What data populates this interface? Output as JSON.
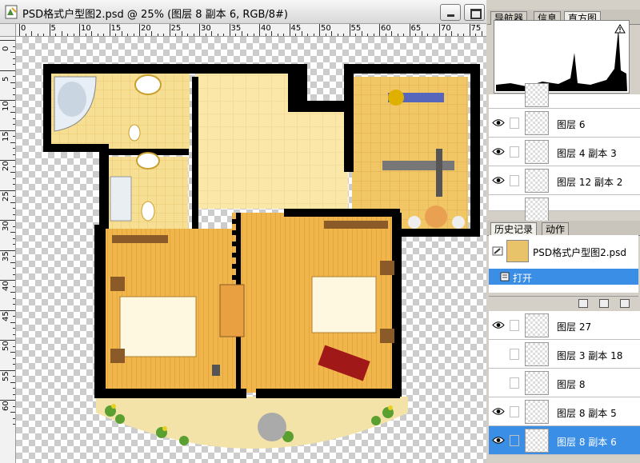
{
  "document": {
    "title": "PSD格式户型图2.psd @ 25% (图层 8 副本 6, RGB/8#)"
  },
  "rulers": {
    "horizontal": [
      "0",
      "5",
      "10",
      "15",
      "20",
      "25",
      "30",
      "35",
      "40",
      "45",
      "50",
      "55",
      "60",
      "65",
      "70",
      "75"
    ],
    "vertical": [
      "0",
      "5",
      "10",
      "15",
      "20",
      "25",
      "30",
      "35",
      "40",
      "45",
      "50",
      "55",
      "60"
    ]
  },
  "navigator_panel": {
    "tabs": [
      "导航器",
      "信息",
      "直方图"
    ],
    "active_tab": "直方图"
  },
  "layers_top": [
    {
      "name": "图层 6",
      "visible": true
    },
    {
      "name": "图层 4 副本 3",
      "visible": true
    },
    {
      "name": "图层 12 副本 2",
      "visible": true
    }
  ],
  "history_panel": {
    "tabs": [
      "历史记录",
      "动作"
    ],
    "active_tab": "历史记录",
    "snapshot_name": "PSD格式户型图2.psd",
    "steps": [
      "打开"
    ]
  },
  "layers_bottom": [
    {
      "name": "图层 27",
      "visible": true,
      "selected": false
    },
    {
      "name": "图层 3 副本 18",
      "visible": false,
      "selected": false
    },
    {
      "name": "图层 8",
      "visible": false,
      "selected": false
    },
    {
      "name": "图层 8 副本 5",
      "visible": true,
      "selected": false
    },
    {
      "name": "图层 8 副本 6",
      "visible": true,
      "selected": true
    }
  ],
  "colors": {
    "selection": "#3a8ee6",
    "wall": "#000000",
    "floor_tile": "#f5dc8c",
    "wood_floor": "#e8a83a"
  }
}
